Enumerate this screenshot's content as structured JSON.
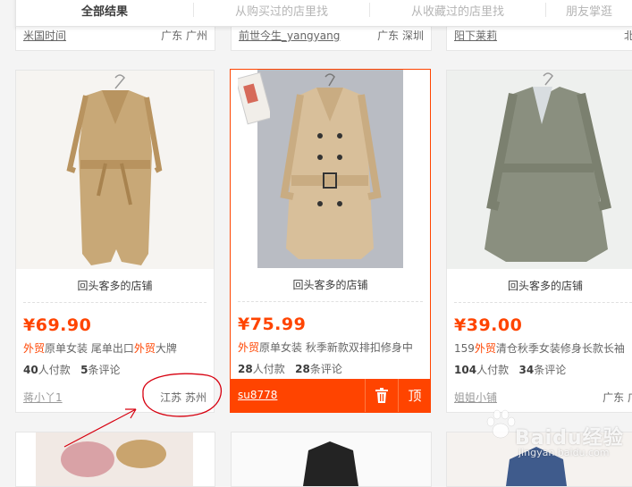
{
  "tabs": [
    {
      "label": "全部结果",
      "active": true
    },
    {
      "label": "从购买过的店里找",
      "active": false
    },
    {
      "label": "从收藏过的店里找",
      "active": false
    },
    {
      "label": "朋友掌逛",
      "active": false
    }
  ],
  "top_row": [
    {
      "seller": "米国时间",
      "location": "广东 广州"
    },
    {
      "seller": "前世今生_yangyang",
      "location": "广东 深圳"
    },
    {
      "seller": "阳下莱莉",
      "location": "北京"
    }
  ],
  "products": [
    {
      "shop": "回头客多的店铺",
      "price": "¥69.90",
      "title_parts": [
        "外贸",
        "原单女装 尾单出口",
        "外贸",
        "大牌"
      ],
      "paid_count": "40",
      "paid_label": "人付款",
      "review_count": "5",
      "review_label": "条评论",
      "seller": "蒋小丫1",
      "location": "江苏 苏州",
      "coat_color": "#c8a877"
    },
    {
      "shop": "回头客多的店铺",
      "price": "¥75.99",
      "title_parts": [
        "外贸",
        "原单女装 秋季新款双排扣修身中"
      ],
      "paid_count": "28",
      "paid_label": "人付款",
      "review_count": "28",
      "review_label": "条评论",
      "seller": "su8778",
      "delete_icon": "trash-icon",
      "top_label": "顶",
      "coat_color": "#d8bf9a"
    },
    {
      "shop": "回头客多的店铺",
      "price": "¥39.00",
      "title_parts": [
        "159",
        "外贸",
        "清仓秋季女装修身长款长袖"
      ],
      "paid_count": "104",
      "paid_label": "人付款",
      "review_count": "34",
      "review_label": "条评论",
      "seller": "姐姐小铺",
      "location": "广东 广州",
      "coat_color": "#8a8f7f"
    }
  ],
  "watermark": {
    "brand": "Baidu经验",
    "url": "jingyan.baidu.com"
  },
  "colors": {
    "accent": "#ff4400",
    "annotation": "#d7000f"
  }
}
